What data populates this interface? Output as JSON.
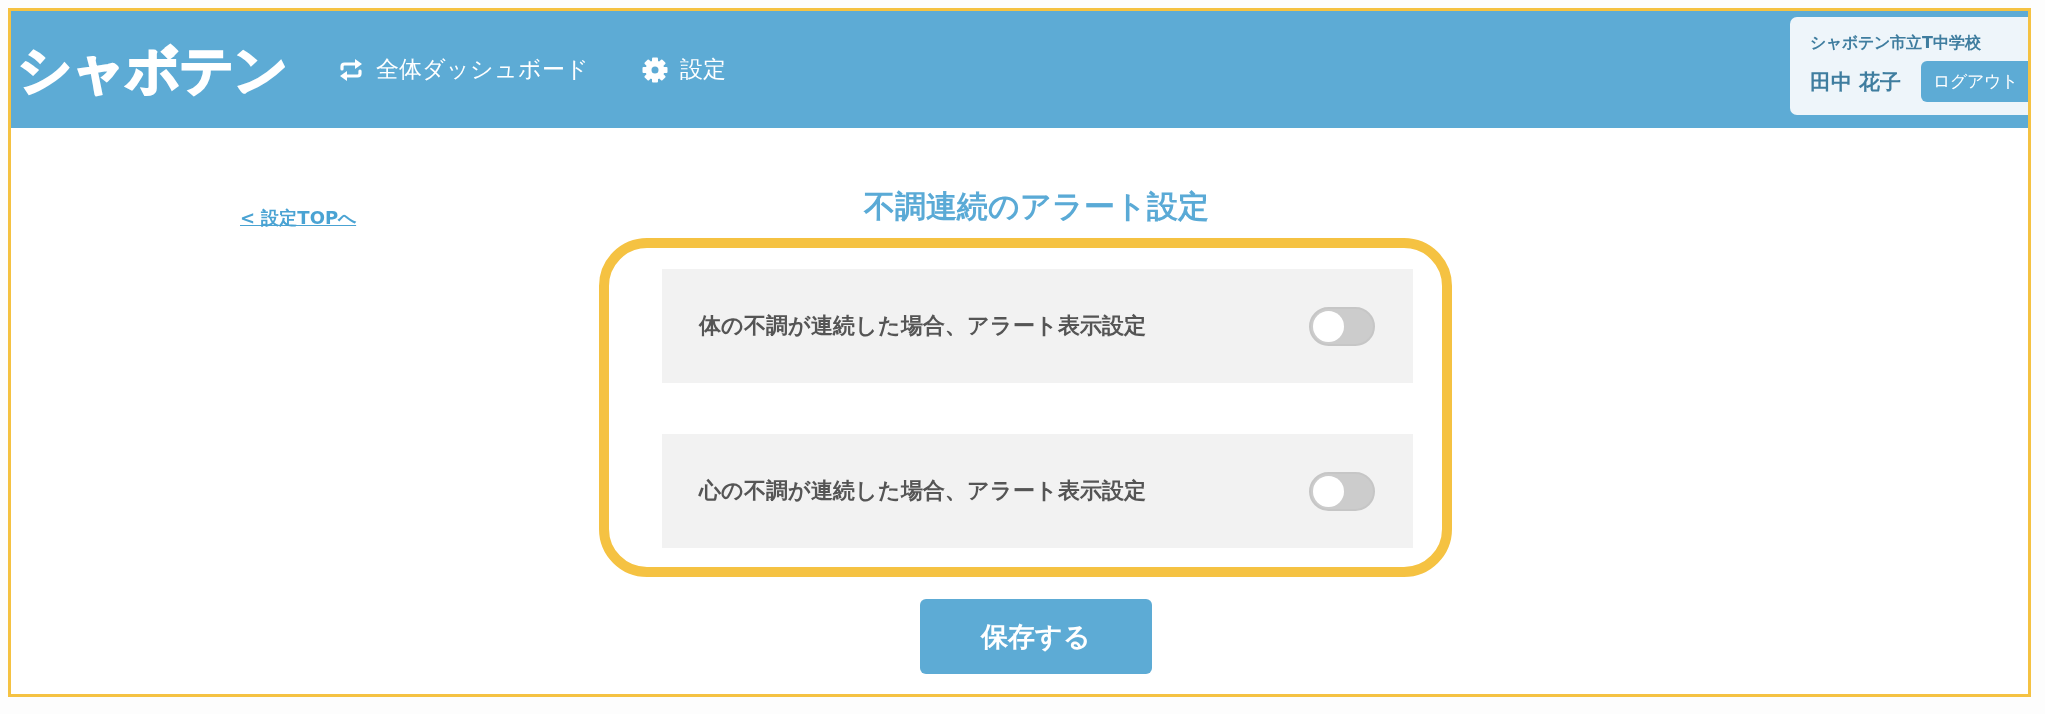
{
  "header": {
    "logo": "シャボテン",
    "nav": [
      {
        "kind": "sync",
        "label": "全体ダッシュボード"
      },
      {
        "kind": "gear",
        "label": "設定"
      }
    ],
    "user": {
      "school": "シャボテン市立T中学校",
      "name": "田中 花子",
      "logout": "ログアウト"
    }
  },
  "back_link": "< 設定TOPへ",
  "title": "不調連続のアラート設定",
  "settings": [
    {
      "label": "体の不調が連続した場合、アラート表示設定",
      "on": false
    },
    {
      "label": "心の不調が連続した場合、アラート表示設定",
      "on": false
    }
  ],
  "save_button": "保存する"
}
